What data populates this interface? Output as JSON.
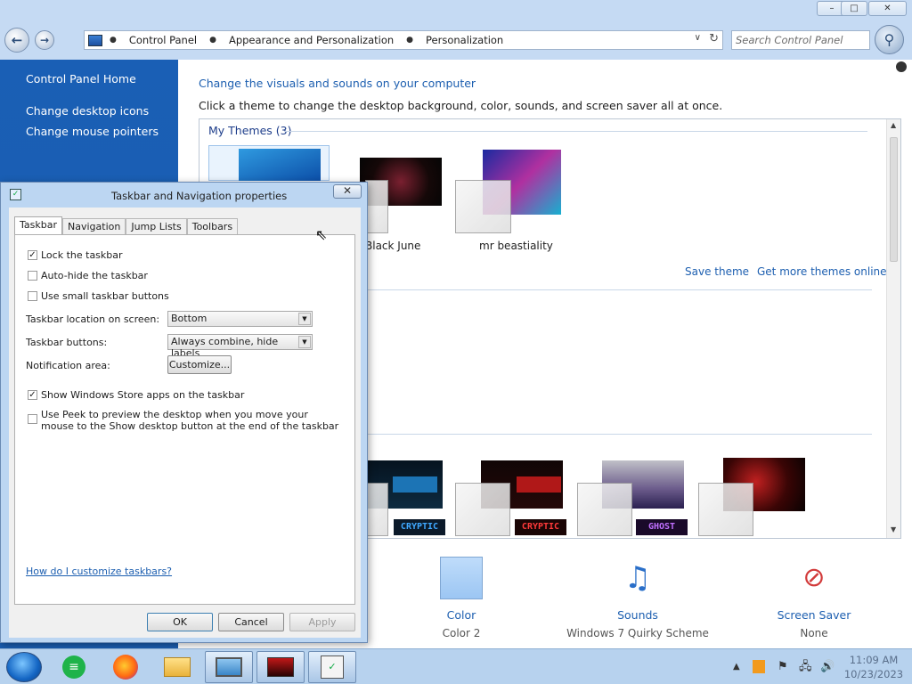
{
  "window": {
    "minimize": "–",
    "maximize": "□",
    "close": "✕"
  },
  "address": {
    "crumbs": [
      "Control Panel",
      "Appearance and Personalization",
      "Personalization"
    ],
    "search_placeholder": "Search Control Panel"
  },
  "sidebar": {
    "items": [
      {
        "label": "Control Panel Home"
      },
      {
        "label": "Change desktop icons"
      },
      {
        "label": "Change mouse pointers"
      }
    ]
  },
  "main": {
    "title": "Change the visuals and sounds on your computer",
    "description": "Click a theme to change the desktop background, color, sounds, and screen saver all at once.",
    "my_themes_heading": "My Themes (3)",
    "themes": [
      {
        "name": "Black June"
      },
      {
        "name": "mr beastiality"
      }
    ],
    "save_theme": "Save theme",
    "get_more": "Get more themes online",
    "installed_thumbs": [
      "CRYPTIC",
      "CRYPTIC",
      "GHOST"
    ]
  },
  "bottom": {
    "color_label": "Color",
    "color_value": "Color 2",
    "sounds_label": "Sounds",
    "sounds_value": "Windows 7 Quirky Scheme",
    "screensaver_label": "Screen Saver",
    "screensaver_value": "None"
  },
  "dialog": {
    "title": "Taskbar and Navigation properties",
    "tabs": [
      "Taskbar",
      "Navigation",
      "Jump Lists",
      "Toolbars"
    ],
    "lock_taskbar": "Lock the taskbar",
    "auto_hide": "Auto-hide the taskbar",
    "small_buttons": "Use small taskbar buttons",
    "location_label": "Taskbar location on screen:",
    "location_value": "Bottom",
    "buttons_label": "Taskbar buttons:",
    "buttons_value": "Always combine, hide labels",
    "notification_label": "Notification area:",
    "customize": "Customize...",
    "store_apps": "Show Windows Store apps on the taskbar",
    "peek": "Use Peek to preview the desktop when you move your mouse to the Show desktop button at the end of the taskbar",
    "help_link": "How do I customize taskbars?",
    "ok": "OK",
    "cancel": "Cancel",
    "apply": "Apply"
  },
  "taskbar": {
    "time": "11:09 AM",
    "date": "10/23/2023"
  },
  "colors": {
    "sidebar": "#1a5eb3",
    "link": "#1d5fb0",
    "chrome": "#c5daf3"
  }
}
